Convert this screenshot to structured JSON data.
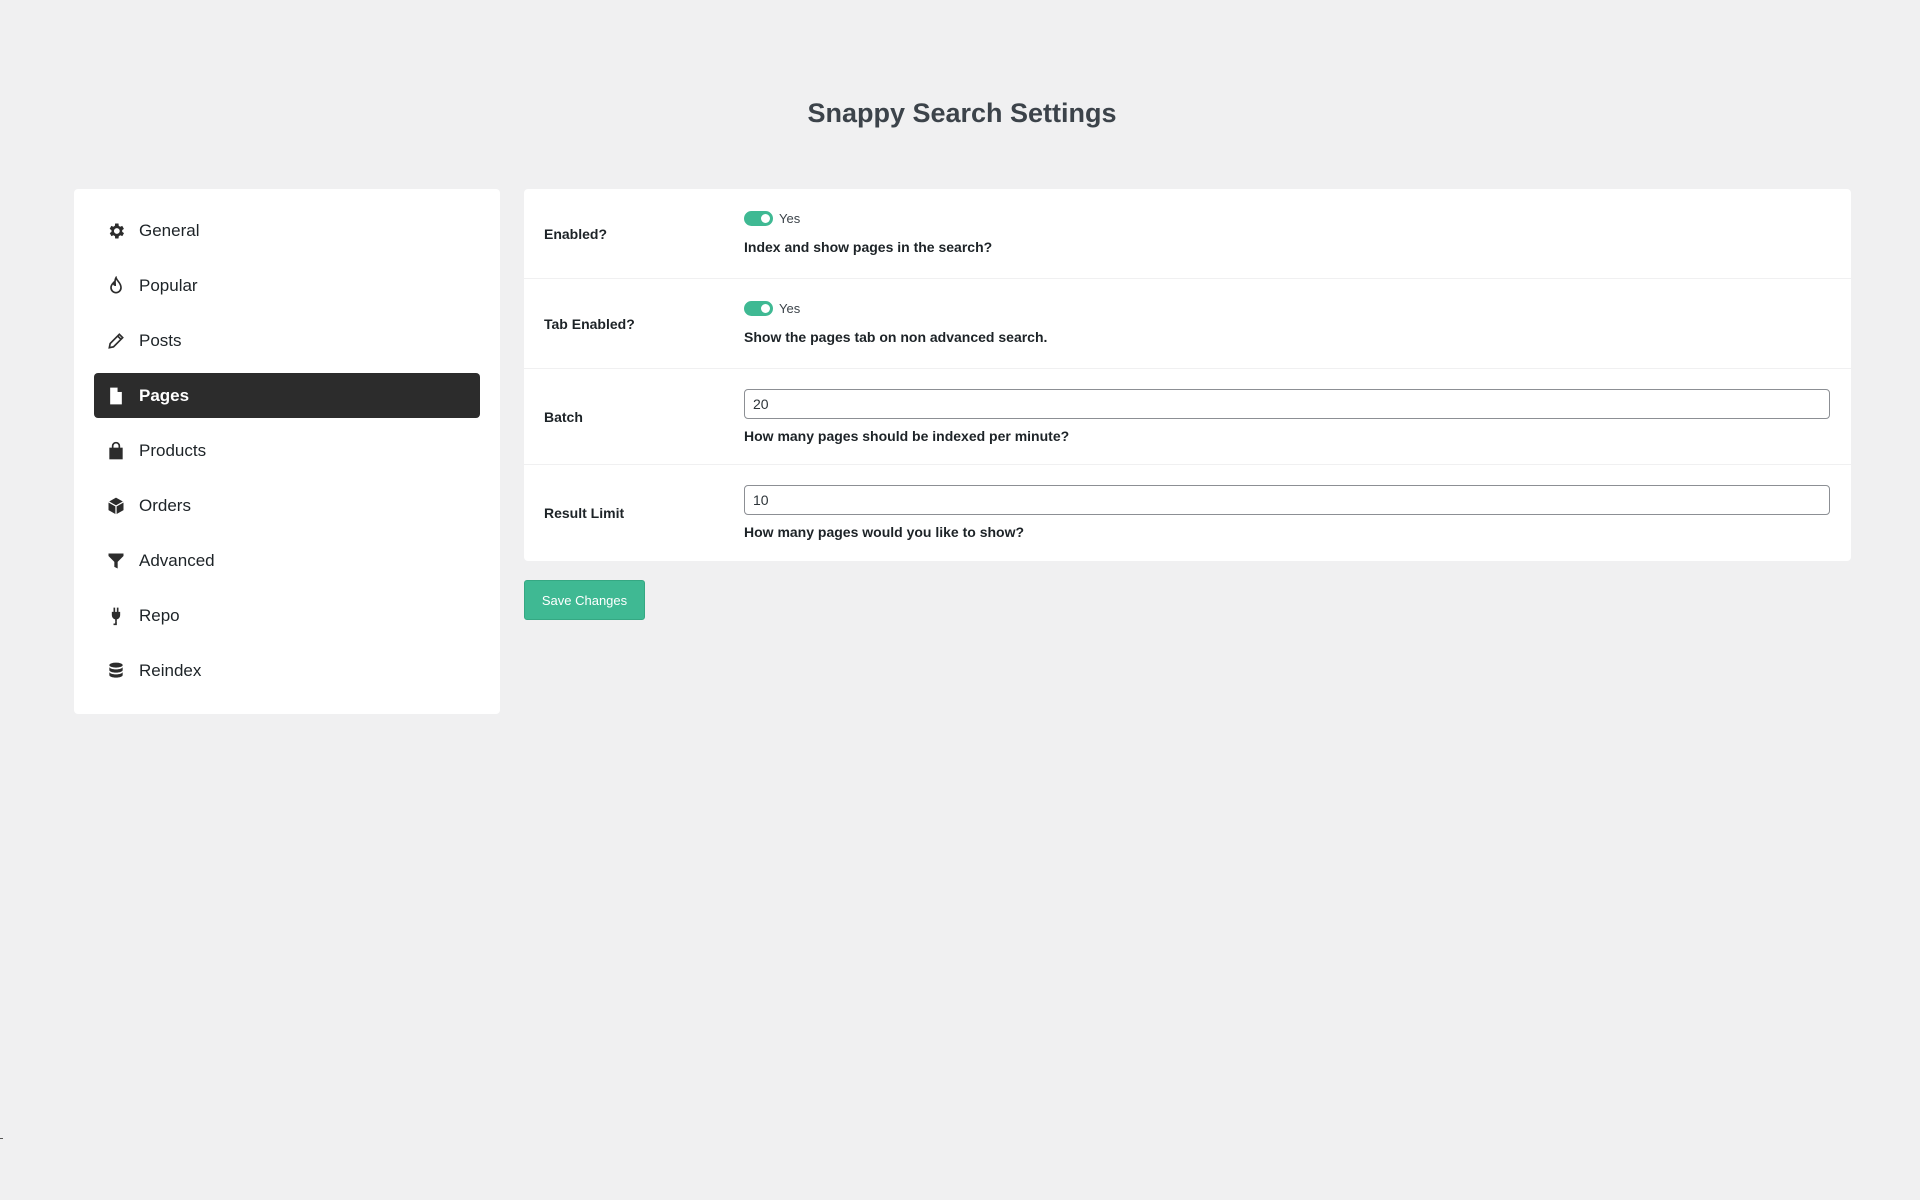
{
  "page": {
    "title": "Snappy Search Settings"
  },
  "sidebar": {
    "items": [
      {
        "label": "General",
        "icon": "gear-icon"
      },
      {
        "label": "Popular",
        "icon": "flame-icon"
      },
      {
        "label": "Posts",
        "icon": "pencil-icon"
      },
      {
        "label": "Pages",
        "icon": "file-icon",
        "active": true
      },
      {
        "label": "Products",
        "icon": "shopping-bag-icon"
      },
      {
        "label": "Orders",
        "icon": "box-icon"
      },
      {
        "label": "Advanced",
        "icon": "filter-icon"
      },
      {
        "label": "Repo",
        "icon": "plug-icon"
      },
      {
        "label": "Reindex",
        "icon": "database-icon"
      }
    ]
  },
  "settings": {
    "enabled": {
      "label": "Enabled?",
      "toggle_text": "Yes",
      "checked": true,
      "help": "Index and show pages in the search?"
    },
    "tab_enabled": {
      "label": "Tab Enabled?",
      "toggle_text": "Yes",
      "checked": true,
      "help": "Show the pages tab on non advanced search."
    },
    "batch": {
      "label": "Batch",
      "value": "20",
      "help": "How many pages should be indexed per minute?"
    },
    "result_limit": {
      "label": "Result Limit",
      "value": "10",
      "help": "How many pages would you like to show?"
    }
  },
  "actions": {
    "save_label": "Save Changes"
  },
  "colors": {
    "accent": "#3fb993",
    "active_nav": "#2c2c2c",
    "background": "#f0f0f1"
  }
}
